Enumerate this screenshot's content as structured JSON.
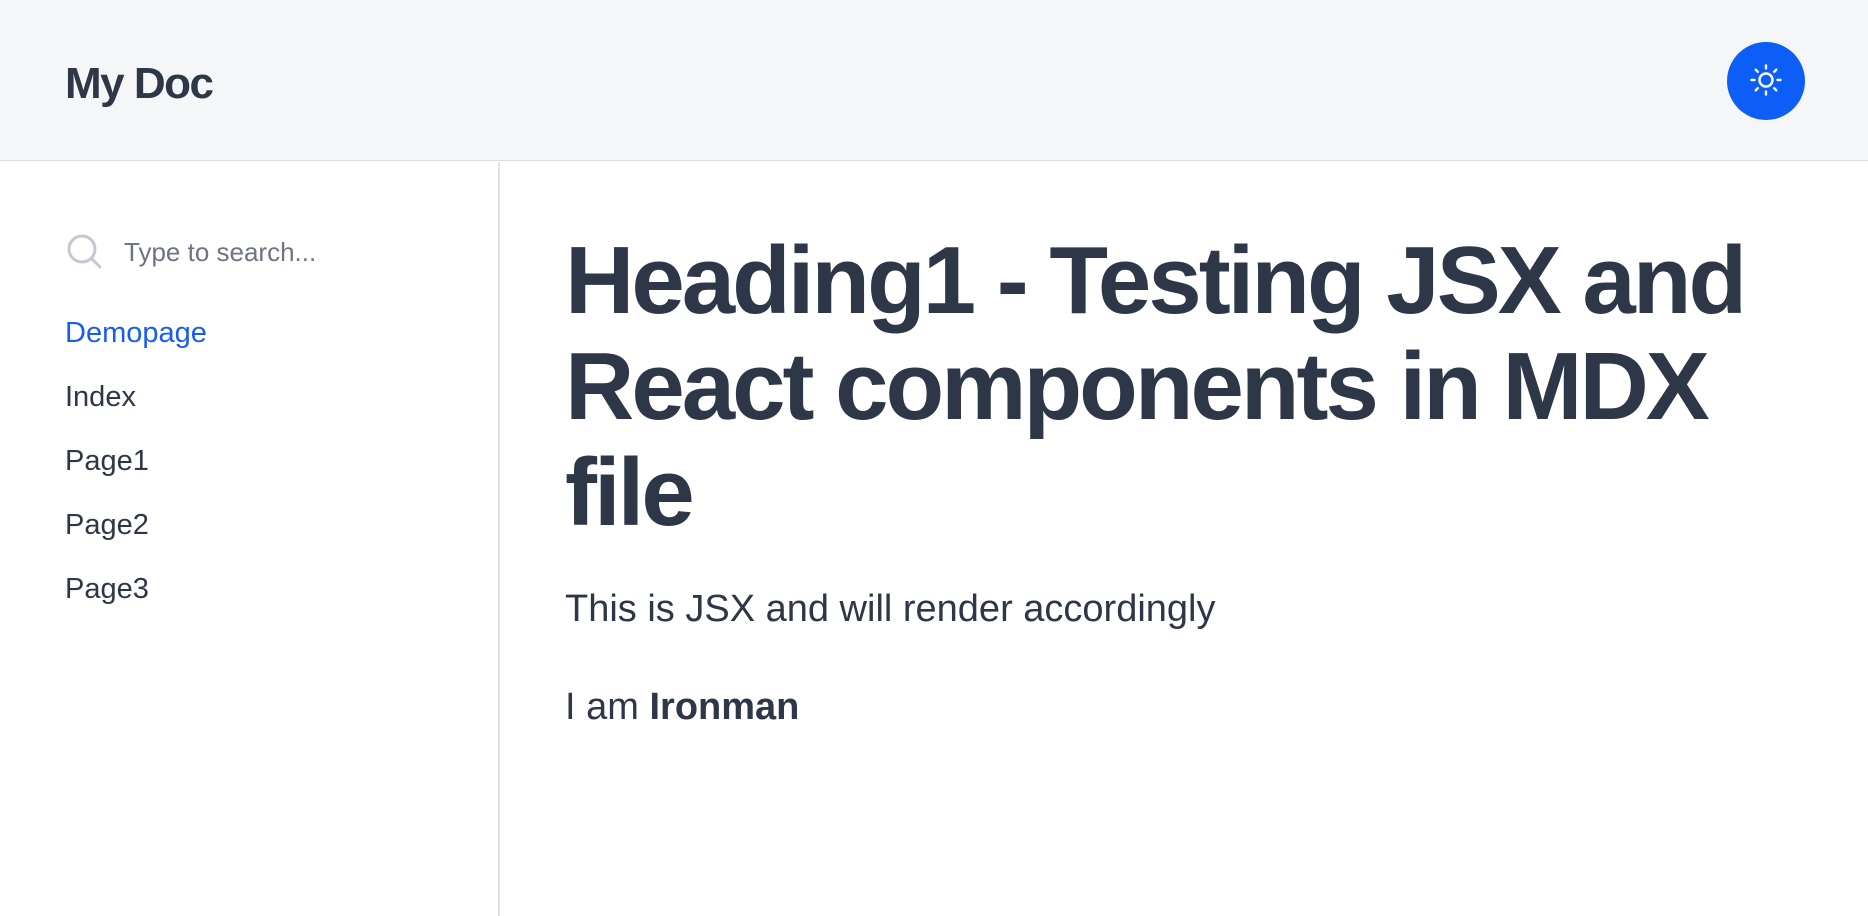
{
  "header": {
    "site_title": "My Doc",
    "theme_toggle_icon": "sun-icon",
    "accent_color": "#0d5ef7"
  },
  "sidebar": {
    "search": {
      "placeholder": "Type to search...",
      "value": "",
      "icon": "search-icon"
    },
    "items": [
      {
        "label": "Demopage",
        "active": true
      },
      {
        "label": "Index",
        "active": false
      },
      {
        "label": "Page1",
        "active": false
      },
      {
        "label": "Page2",
        "active": false
      },
      {
        "label": "Page3",
        "active": false
      }
    ]
  },
  "main": {
    "heading": "Heading1 - Testing JSX and React components in MDX file",
    "intro": "This is JSX and will render accordingly",
    "line2_prefix": "I am ",
    "line2_bold": "Ironman"
  }
}
